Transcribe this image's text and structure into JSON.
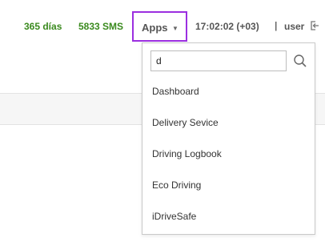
{
  "header": {
    "days": "365 días",
    "sms": "5833 SMS",
    "apps_label": "Apps",
    "time": "17:02:02 (+03)",
    "separator": "|",
    "user": "user"
  },
  "colors": {
    "counter_green": "#3a8a1e",
    "highlight_border": "#9b2fe0"
  },
  "icons": {
    "caret": "caret-down-icon",
    "logout": "logout-icon",
    "search": "search-icon"
  },
  "apps_dropdown": {
    "search_value": "d",
    "items": [
      {
        "label": "Dashboard"
      },
      {
        "label": "Delivery Sevice"
      },
      {
        "label": "Driving Logbook"
      },
      {
        "label": "Eco Driving"
      },
      {
        "label": "iDriveSafe"
      }
    ]
  }
}
